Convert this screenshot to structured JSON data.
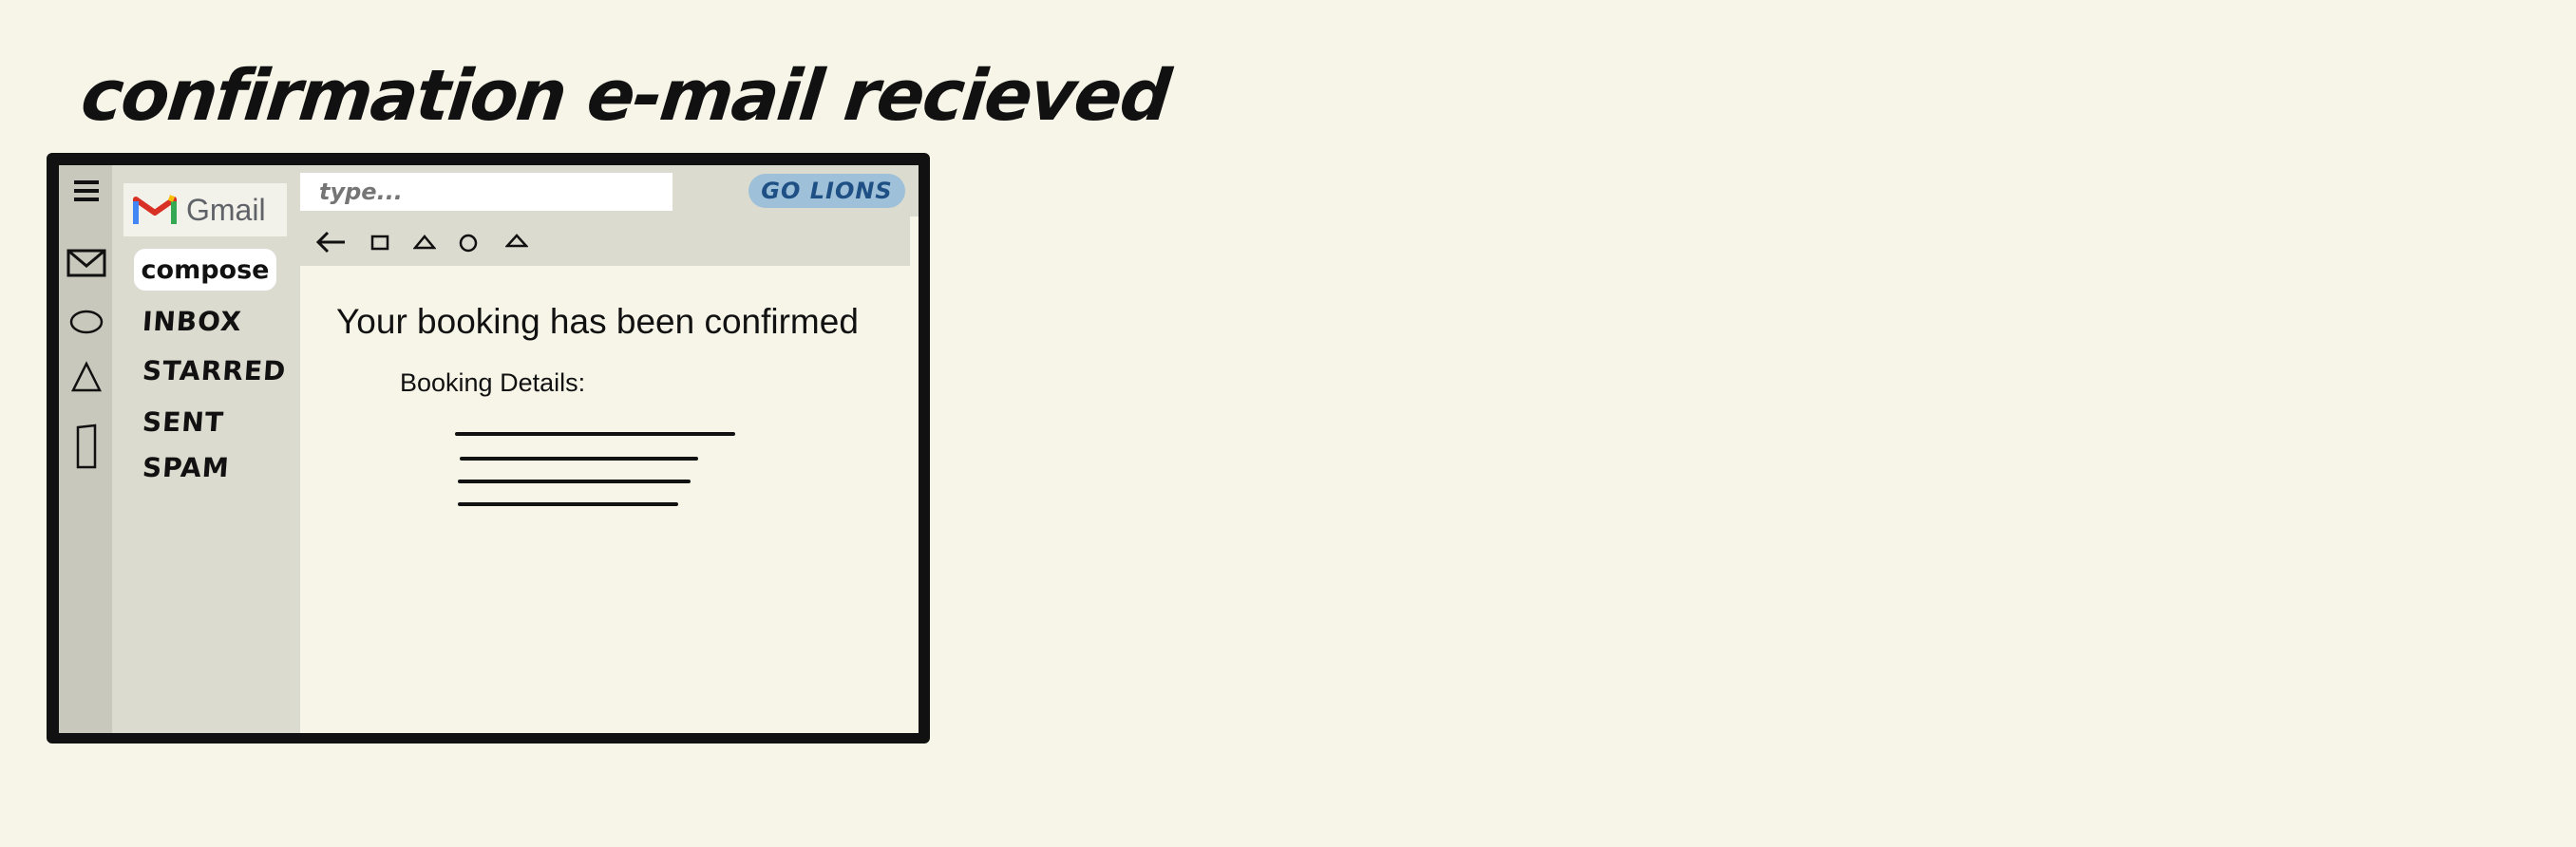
{
  "heading": "confirmation e-mail recieved",
  "sidebar": {
    "logo_text": "Gmail",
    "compose_label": "compose",
    "items": [
      {
        "label": "INBOX"
      },
      {
        "label": "STARRED"
      },
      {
        "label": "SENT"
      },
      {
        "label": "SPAM"
      }
    ]
  },
  "rail_icons": [
    "menu-icon",
    "mail-icon",
    "circle-icon",
    "triangle-icon",
    "rectangle-icon"
  ],
  "search": {
    "placeholder": "type..."
  },
  "badge": "GO LIONS",
  "toolbar_icons": [
    "back-arrow-icon",
    "square-icon",
    "triangle-icon",
    "circle-icon",
    "triangle-icon"
  ],
  "email": {
    "subject": "Your booking has been confirmed",
    "details_label": "Booking Details:"
  },
  "colors": {
    "page_bg": "#f7f5e8",
    "frame": "#111111",
    "sidebar_bg": "#dcdbd0",
    "rail_bg": "#c8c8bc",
    "badge_bg": "#9ec0d8",
    "badge_text": "#1e4f85"
  }
}
